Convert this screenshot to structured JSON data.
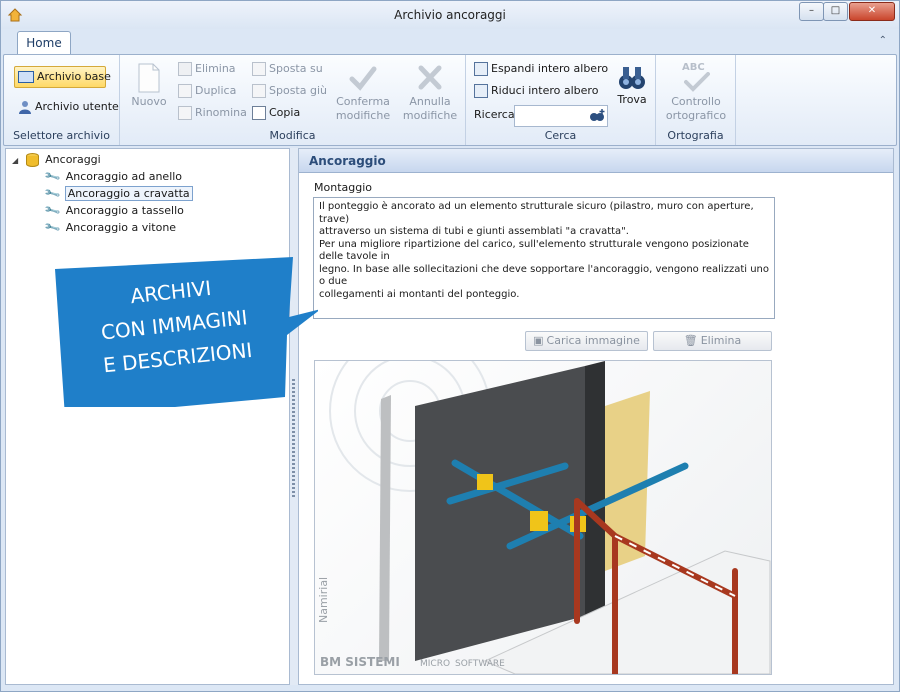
{
  "window": {
    "title": "Archivio ancoraggi",
    "min": "–",
    "max": "□",
    "close": "✕"
  },
  "tabs": [
    {
      "label": "Home"
    }
  ],
  "ribbon": {
    "selettore": {
      "label": "Selettore archivio",
      "archivio_base": "Archivio base",
      "archivio_utente": "Archivio utente"
    },
    "modifica": {
      "label": "Modifica",
      "nuovo": "Nuovo",
      "elimina": "Elimina",
      "duplica": "Duplica",
      "rinomina": "Rinomina",
      "sposta_su": "Sposta su",
      "sposta_giu": "Sposta giù",
      "copia": "Copia",
      "conferma_1": "Conferma",
      "conferma_2": "modifiche",
      "annulla_1": "Annulla",
      "annulla_2": "modifiche"
    },
    "cerca": {
      "label": "Cerca",
      "espandi": "Espandi intero albero",
      "riduci": "Riduci intero albero",
      "ricerca": "Ricerca",
      "search_value": "",
      "trova": "Trova"
    },
    "ortografia": {
      "label": "Ortografia",
      "controllo_1": "Controllo",
      "controllo_2": "ortografico",
      "abc": "ABC"
    }
  },
  "tree": {
    "root": "Ancoraggi",
    "items": [
      {
        "label": "Ancoraggio ad anello",
        "selected": false
      },
      {
        "label": "Ancoraggio a cravatta",
        "selected": true
      },
      {
        "label": "Ancoraggio a tassello",
        "selected": false
      },
      {
        "label": "Ancoraggio a vitone",
        "selected": false
      }
    ]
  },
  "banner": {
    "line1": "ARCHIVI",
    "line2": "CON IMMAGINI",
    "line3": "E DESCRIZIONI"
  },
  "detail": {
    "header": "Ancoraggio",
    "section_label": "Montaggio",
    "description": "Il ponteggio è ancorato ad un elemento strutturale sicuro (pilastro, muro con aperture, trave)\nattraverso un sistema di tubi e giunti assemblati \"a cravatta\".\nPer una migliore ripartizione del carico, sull'elemento strutturale vengono posizionate delle tavole in\nlegno. In base alle sollecitazioni che deve sopportare l'ancoraggio, vengono realizzati uno o due\ncollegamenti ai montanti del ponteggio.",
    "carica_immagine": "Carica immagine",
    "elimina": "Elimina",
    "watermark_1": "Namirial",
    "watermark_2": "BM SISTEMI",
    "watermark_3": "MICRO",
    "watermark_4": "SOFTWARE"
  },
  "colors": {
    "ribbon_bg": "#e2ebf7",
    "banner_blue": "#1f7fc9",
    "selected_bg": "#fff3c4",
    "tube_blue": "#1e7fb0",
    "clamp_yellow": "#f0c419",
    "rail_red": "#a8381f"
  }
}
